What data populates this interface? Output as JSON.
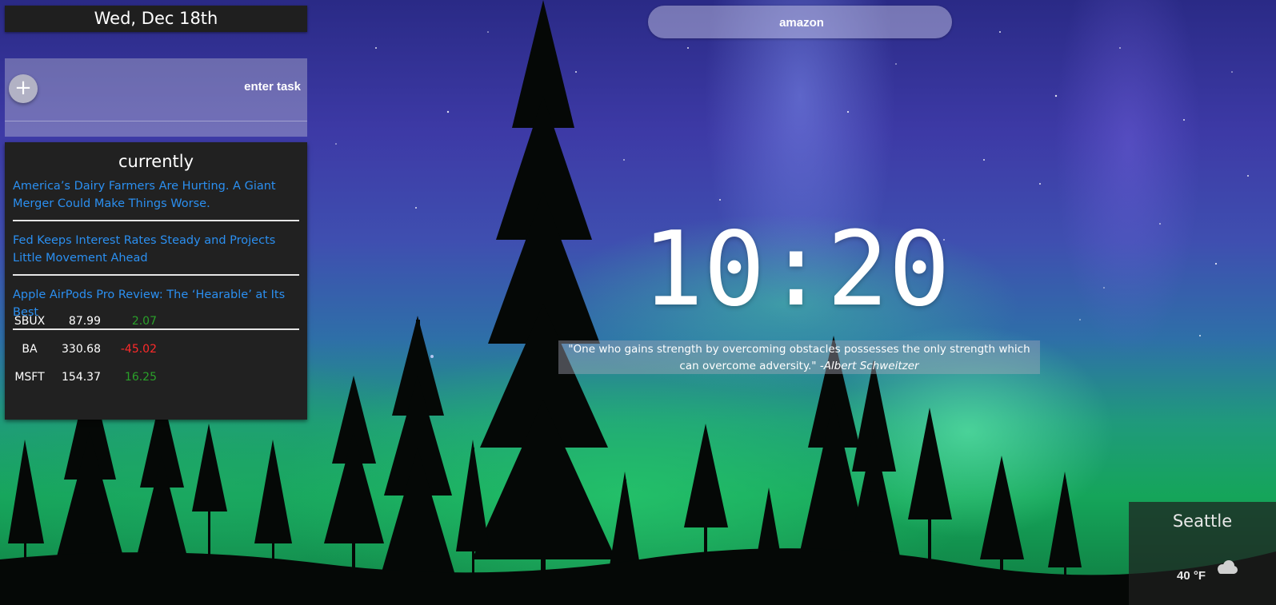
{
  "header": {
    "date": "Wed, Dec 18th"
  },
  "tasks": {
    "add_label": "+",
    "input_placeholder": "enter task"
  },
  "currently": {
    "title": "currently",
    "news": [
      {
        "title": "America’s Dairy Farmers Are Hurting. A Giant Merger Could Make Things Worse."
      },
      {
        "title": "Fed Keeps Interest Rates Steady and Projects Little Movement Ahead"
      },
      {
        "title": "Apple AirPods Pro Review: The ‘Hearable’ at Its Best"
      }
    ],
    "stocks": [
      {
        "symbol": "SBUX",
        "price": "87.99",
        "change": "2.07",
        "direction": "up"
      },
      {
        "symbol": "BA",
        "price": "330.68",
        "change": "-45.02",
        "direction": "down"
      },
      {
        "symbol": "MSFT",
        "price": "154.37",
        "change": "16.25",
        "direction": "up"
      }
    ],
    "colors": {
      "link": "#2b8ff0",
      "up": "#2aa02a",
      "down": "#ff2a2a"
    }
  },
  "search": {
    "placeholder": "amazon"
  },
  "clock": {
    "time": "10:20"
  },
  "quote": {
    "text": "\"One who gains strength by overcoming obstacles possesses the only strength which can overcome adversity.\"",
    "author": "-Albert Schweitzer"
  },
  "weather": {
    "city": "Seattle",
    "temperature": "40 °F",
    "icon": "cloud-icon"
  }
}
